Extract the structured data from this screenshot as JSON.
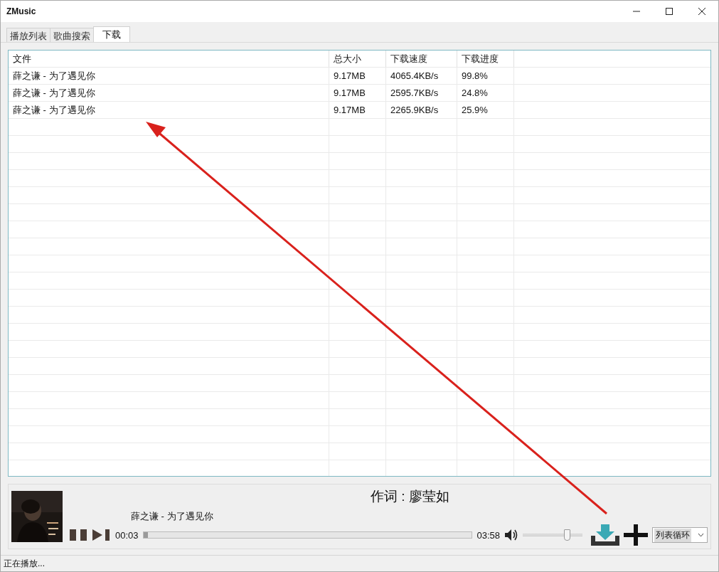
{
  "window": {
    "title": "ZMusic"
  },
  "tabs": [
    {
      "label": "播放列表",
      "selected": false
    },
    {
      "label": "歌曲搜索",
      "selected": false
    },
    {
      "label": "下载",
      "selected": true
    }
  ],
  "table": {
    "columns": [
      "文件",
      "总大小",
      "下载速度",
      "下载进度"
    ],
    "rows": [
      [
        "薛之谦 - 为了遇见你",
        "9.17MB",
        "4065.4KB/s",
        "99.8%"
      ],
      [
        "薛之谦 - 为了遇见你",
        "9.17MB",
        "2595.7KB/s",
        "24.8%"
      ],
      [
        "薛之谦 - 为了遇见你",
        "9.17MB",
        "2265.9KB/s",
        "25.9%"
      ]
    ]
  },
  "player": {
    "lyric": "作词 : 廖莹如",
    "track": "薛之谦 - 为了遇见你",
    "elapsed": "00:03",
    "duration": "03:58",
    "progress": {
      "level": 0.013
    },
    "volume": {
      "level": 0.75
    },
    "play_mode": "列表循环"
  },
  "annotation": {
    "kind": "arrow"
  },
  "status_bar": "正在播放..."
}
